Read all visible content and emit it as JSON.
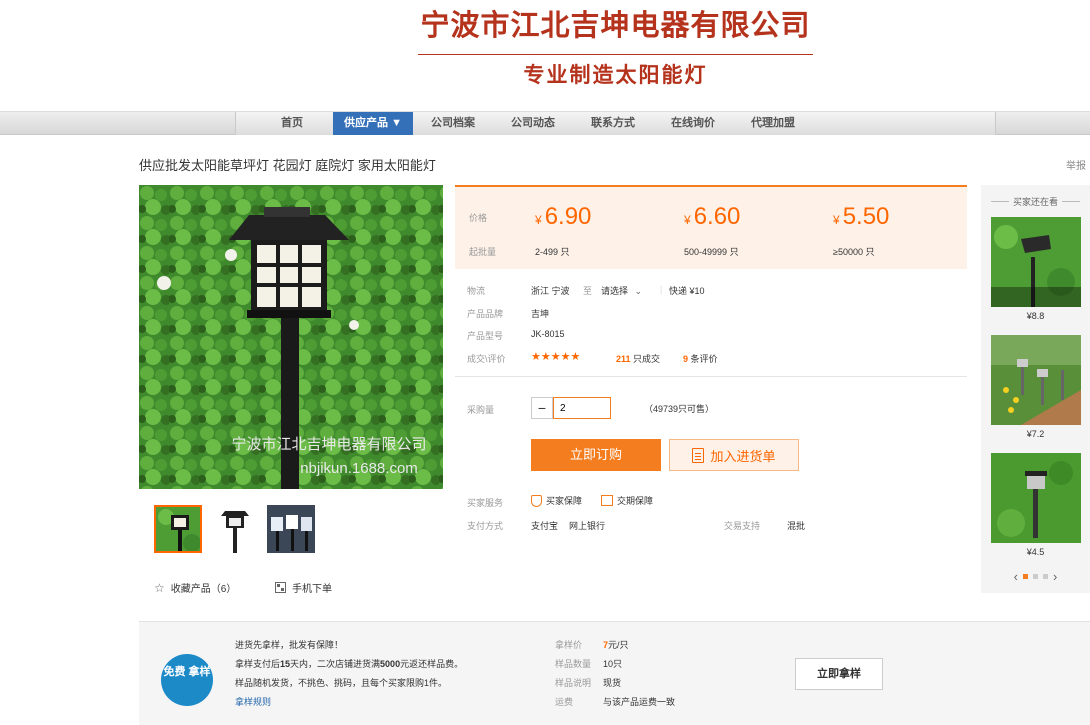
{
  "header": {
    "company_name": "宁波市江北吉坤电器有限公司",
    "slogan": "专业制造太阳能灯"
  },
  "nav": {
    "items": [
      {
        "label": "首页"
      },
      {
        "label": "供应产品 ▼"
      },
      {
        "label": "公司档案"
      },
      {
        "label": "公司动态"
      },
      {
        "label": "联系方式"
      },
      {
        "label": "在线询价"
      },
      {
        "label": "代理加盟"
      }
    ],
    "active_index": 1,
    "active_color": "#3470b8"
  },
  "product": {
    "title": "供应批发太阳能草坪灯 花园灯 庭院灯 家用太阳能灯",
    "report": "举报",
    "watermark_line1": "宁波市江北吉坤电器有限公司",
    "watermark_line2": "nbjikun.1688.com"
  },
  "price": {
    "price_label": "价格",
    "moq_label": "起批量",
    "currency": "¥",
    "tiers": [
      {
        "price": "6.90",
        "range": "2-499",
        "unit": "只"
      },
      {
        "price": "6.60",
        "range": "500-49999",
        "unit": "只"
      },
      {
        "price": "5.50",
        "range": "≥50000",
        "unit": "只"
      }
    ],
    "accent_color": "#f47d1f"
  },
  "details": {
    "logistics_label": "物流",
    "origin": "浙江 宁波",
    "to": "至",
    "select": "请选择",
    "shipping": "快递 ¥10",
    "brand_label": "产品品牌",
    "brand": "吉坤",
    "model_label": "产品型号",
    "model": "JK-8015",
    "deal_label": "成交\\评价",
    "stars": "★★★★★",
    "sold_count": "211",
    "sold_text": "只成交",
    "review_count": "9",
    "review_text": "条评价"
  },
  "purchase": {
    "qty_label": "采购量",
    "minus": "−",
    "qty_value": "2",
    "available": "（49739只可售）",
    "buy_label": "立即订购",
    "cart_label": "加入进货单"
  },
  "services": {
    "buyer_label": "买家服务",
    "guarantee1": "买家保障",
    "guarantee2": "交期保障",
    "pay_label": "支付方式",
    "pay1": "支付宝",
    "pay2": "网上银行",
    "trade_label": "交易支持",
    "trade_value": "混批"
  },
  "gallery": {
    "favorites": "收藏产品（6）",
    "mobile_order": "手机下单"
  },
  "sidebar": {
    "title": "买家还在看",
    "items": [
      {
        "price": "¥8.8"
      },
      {
        "price": "¥7.2"
      },
      {
        "price": "¥4.5"
      }
    ],
    "prev": "‹",
    "next": "›"
  },
  "sample": {
    "badge": "免费 拿样",
    "line1": "进货先拿样，批发有保障！",
    "line2_prefix": "拿样支付后",
    "line2_days": "15",
    "line2_mid": "天内，二次店铺进货满",
    "line2_amount": "5000",
    "line2_suffix": "元返还样品费。",
    "line3": "样品随机发货，不挑色、挑码，且每个买家限购1件。",
    "rules_link": "拿样规则",
    "price_label": "拿样价",
    "price_value": "7",
    "price_unit": "元/只",
    "qty_label": "样品数量",
    "qty_value": "10只",
    "desc_label": "样品说明",
    "desc_value": "现货",
    "freight_label": "运费",
    "freight_value": "与该产品运费一致",
    "button": "立即拿样"
  }
}
